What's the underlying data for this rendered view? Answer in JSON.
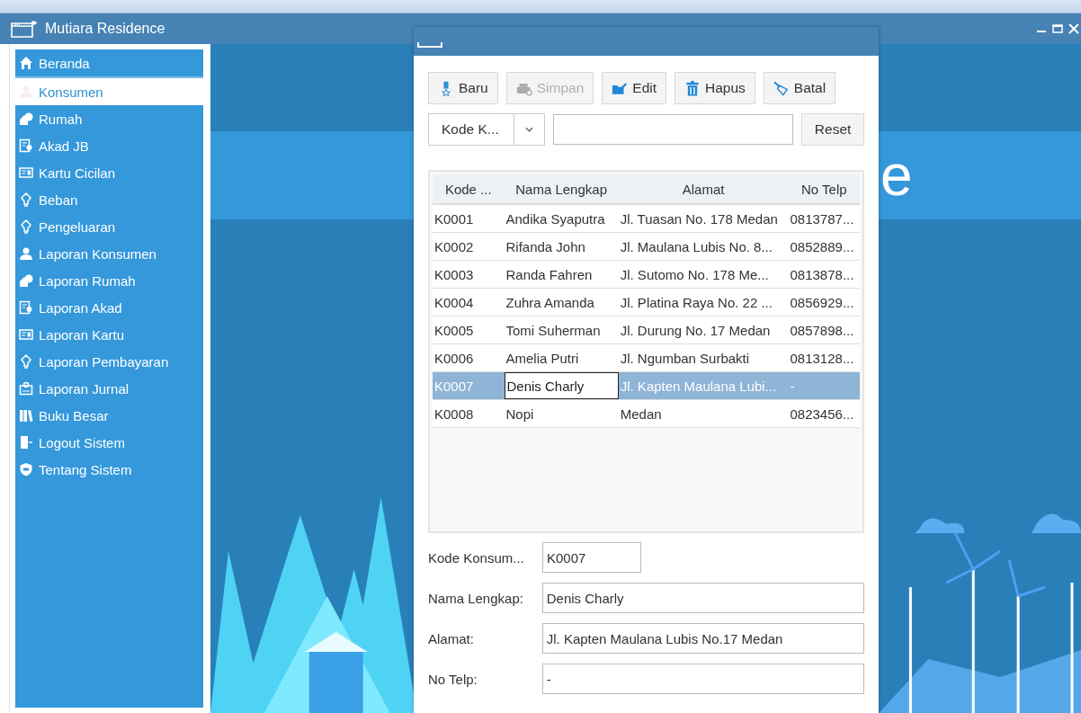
{
  "window": {
    "title": "Mutiara Residence"
  },
  "sidebar": {
    "items": [
      {
        "label": "Beranda",
        "selected": false
      },
      {
        "label": "Konsumen",
        "selected": true
      },
      {
        "label": "Rumah",
        "selected": false
      },
      {
        "label": "Akad JB",
        "selected": false
      },
      {
        "label": "Kartu Cicilan",
        "selected": false
      },
      {
        "label": "Beban",
        "selected": false
      },
      {
        "label": "Pengeluaran",
        "selected": false
      },
      {
        "label": "Laporan Konsumen",
        "selected": false
      },
      {
        "label": "Laporan Rumah",
        "selected": false
      },
      {
        "label": "Laporan Akad",
        "selected": false
      },
      {
        "label": "Laporan Kartu",
        "selected": false
      },
      {
        "label": "Laporan Pembayaran",
        "selected": false
      },
      {
        "label": "Laporan Jurnal",
        "selected": false
      },
      {
        "label": "Buku Besar",
        "selected": false
      },
      {
        "label": "Logout Sistem",
        "selected": false
      },
      {
        "label": "Tentang Sistem",
        "selected": false
      }
    ]
  },
  "banner": {
    "right_fragment": "e"
  },
  "dialog": {
    "toolbar": [
      {
        "label": "Baru",
        "disabled": false
      },
      {
        "label": "Simpan",
        "disabled": true
      },
      {
        "label": "Edit",
        "disabled": false
      },
      {
        "label": "Hapus",
        "disabled": false
      },
      {
        "label": "Batal",
        "disabled": false
      }
    ],
    "search": {
      "filter": "Kode K...",
      "button": "Reset"
    },
    "table": {
      "columns": [
        "Kode ...",
        "Nama Lengkap",
        "Alamat",
        "No Telp"
      ],
      "rows": [
        {
          "cells": [
            "K0001",
            "Andika Syaputra",
            "Jl. Tuasan No. 178 Medan",
            "0813787..."
          ],
          "selected": false
        },
        {
          "cells": [
            "K0002",
            "Rifanda John",
            "Jl. Maulana Lubis No. 8...",
            "0852889..."
          ],
          "selected": false
        },
        {
          "cells": [
            "K0003",
            "Randa Fahren",
            "Jl. Sutomo No. 178 Me...",
            "0813878..."
          ],
          "selected": false
        },
        {
          "cells": [
            "K0004",
            "Zuhra Amanda",
            "Jl. Platina Raya No. 22 ...",
            "0856929..."
          ],
          "selected": false
        },
        {
          "cells": [
            "K0005",
            "Tomi Suherman",
            "Jl. Durung No. 17 Medan",
            "0857898..."
          ],
          "selected": false
        },
        {
          "cells": [
            "K0006",
            "Amelia Putri",
            "Jl. Ngumban Surbakti",
            "0813128..."
          ],
          "selected": false
        },
        {
          "cells": [
            "K0007",
            "Denis Charly",
            "Jl. Kapten Maulana Lubi...",
            "-"
          ],
          "selected": true
        },
        {
          "cells": [
            "K0008",
            "Nopi",
            "Medan",
            "0823456..."
          ],
          "selected": false
        }
      ]
    },
    "form": [
      {
        "label": "Kode Konsum...",
        "value": "K0007"
      },
      {
        "label": "Nama Lengkap:",
        "value": "Denis Charly"
      },
      {
        "label": "Alamat:",
        "value": "Jl. Kapten Maulana Lubis No.17 Medan"
      },
      {
        "label": "No Telp:",
        "value": "-"
      }
    ]
  }
}
